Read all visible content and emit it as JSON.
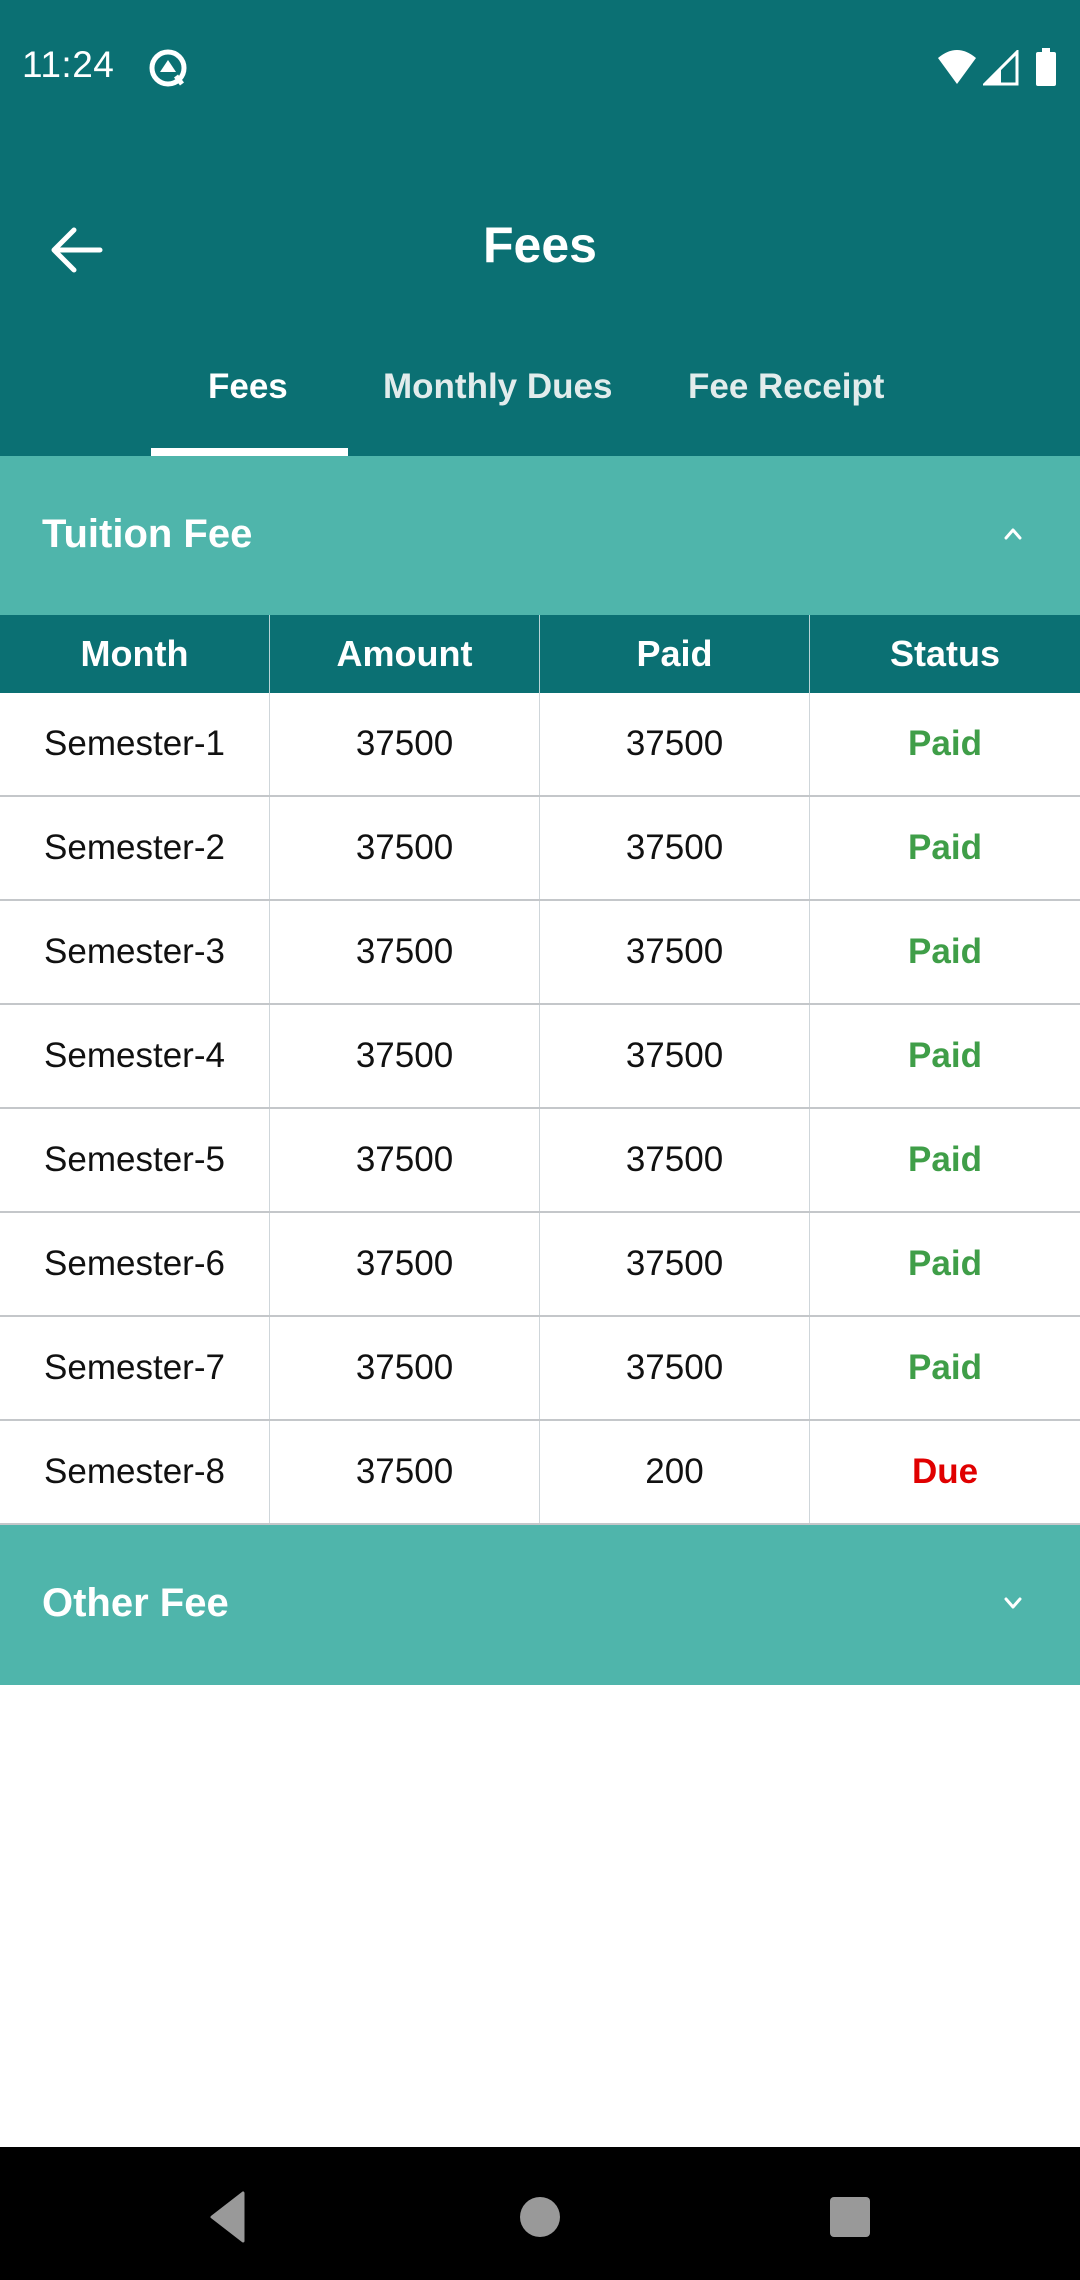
{
  "status_bar": {
    "time": "11:24",
    "icons": [
      "data-saver-icon",
      "wifi-icon",
      "cellular-signal-icon",
      "battery-icon"
    ]
  },
  "header": {
    "title": "Fees",
    "back_icon": "arrow-back-icon"
  },
  "tabs": [
    {
      "label": "Fees",
      "active": true
    },
    {
      "label": "Monthly Dues",
      "active": false
    },
    {
      "label": "Fee Receipt",
      "active": false
    }
  ],
  "sections": {
    "tuition": {
      "title": "Tuition Fee",
      "expanded": true,
      "icon": "chevron-up-icon"
    },
    "other": {
      "title": "Other Fee",
      "expanded": false,
      "icon": "chevron-down-icon"
    }
  },
  "table": {
    "columns": [
      "Month",
      "Amount",
      "Paid",
      "Status"
    ],
    "rows": [
      {
        "month": "Semester-1",
        "amount": "37500",
        "paid": "37500",
        "status": "Paid"
      },
      {
        "month": "Semester-2",
        "amount": "37500",
        "paid": "37500",
        "status": "Paid"
      },
      {
        "month": "Semester-3",
        "amount": "37500",
        "paid": "37500",
        "status": "Paid"
      },
      {
        "month": "Semester-4",
        "amount": "37500",
        "paid": "37500",
        "status": "Paid"
      },
      {
        "month": "Semester-5",
        "amount": "37500",
        "paid": "37500",
        "status": "Paid"
      },
      {
        "month": "Semester-6",
        "amount": "37500",
        "paid": "37500",
        "status": "Paid"
      },
      {
        "month": "Semester-7",
        "amount": "37500",
        "paid": "37500",
        "status": "Paid"
      },
      {
        "month": "Semester-8",
        "amount": "37500",
        "paid": "200",
        "status": "Due"
      }
    ]
  },
  "colors": {
    "primary_dark": "#0b7073",
    "section_bg": "#4fb5ab",
    "status_paid": "#3f9e48",
    "status_due": "#e00000"
  },
  "nav_bar": {
    "buttons": [
      "back",
      "home",
      "recents"
    ]
  }
}
